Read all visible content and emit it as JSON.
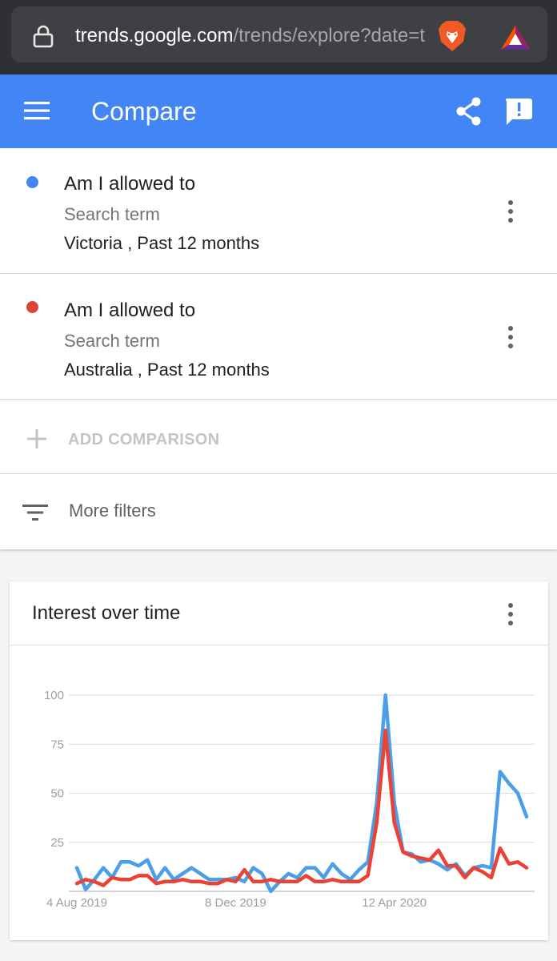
{
  "browser": {
    "url_domain": "trends.google.com",
    "url_path": "/trends/explore?date=t"
  },
  "header": {
    "title": "Compare"
  },
  "terms": [
    {
      "name": "Am I allowed to",
      "type": "Search term",
      "region": "Victoria , Past 12 months",
      "color": "#4285f4"
    },
    {
      "name": "Am I allowed to",
      "type": "Search term",
      "region": "Australia , Past 12 months",
      "color": "#db4437"
    }
  ],
  "add_comparison_label": "ADD COMPARISON",
  "more_filters_label": "More filters",
  "interest": {
    "title": "Interest over time"
  },
  "chart_data": {
    "type": "line",
    "y_ticks": [
      "100",
      "75",
      "50",
      "25"
    ],
    "x_tick_labels": [
      "4 Aug 2019",
      "8 Dec 2019",
      "12 Apr 2020"
    ],
    "x_tick_weeks": [
      0,
      18,
      36
    ],
    "ylim": [
      0,
      100
    ],
    "grid": true,
    "series": [
      {
        "color": "#4a9fe8",
        "values": [
          12,
          1,
          6,
          12,
          7,
          15,
          15,
          13,
          16,
          6,
          12,
          6,
          9,
          12,
          9,
          6,
          6,
          6,
          7,
          5,
          12,
          9,
          0,
          5,
          9,
          7,
          12,
          12,
          7,
          14,
          9,
          6,
          11,
          15,
          45,
          100,
          45,
          20,
          19,
          15,
          16,
          14,
          11,
          14,
          8,
          12,
          13,
          12,
          61,
          55,
          50,
          38
        ]
      },
      {
        "color": "#ea4335",
        "values": [
          4,
          6,
          5,
          3,
          7,
          6,
          6,
          8,
          8,
          4,
          5,
          5,
          6,
          5,
          5,
          4,
          4,
          6,
          5,
          11,
          5,
          5,
          6,
          5,
          5,
          5,
          8,
          5,
          5,
          6,
          5,
          5,
          5,
          8,
          35,
          82,
          35,
          20,
          18,
          17,
          16,
          21,
          13,
          13,
          7,
          12,
          10,
          7,
          22,
          14,
          15,
          12
        ]
      }
    ]
  }
}
